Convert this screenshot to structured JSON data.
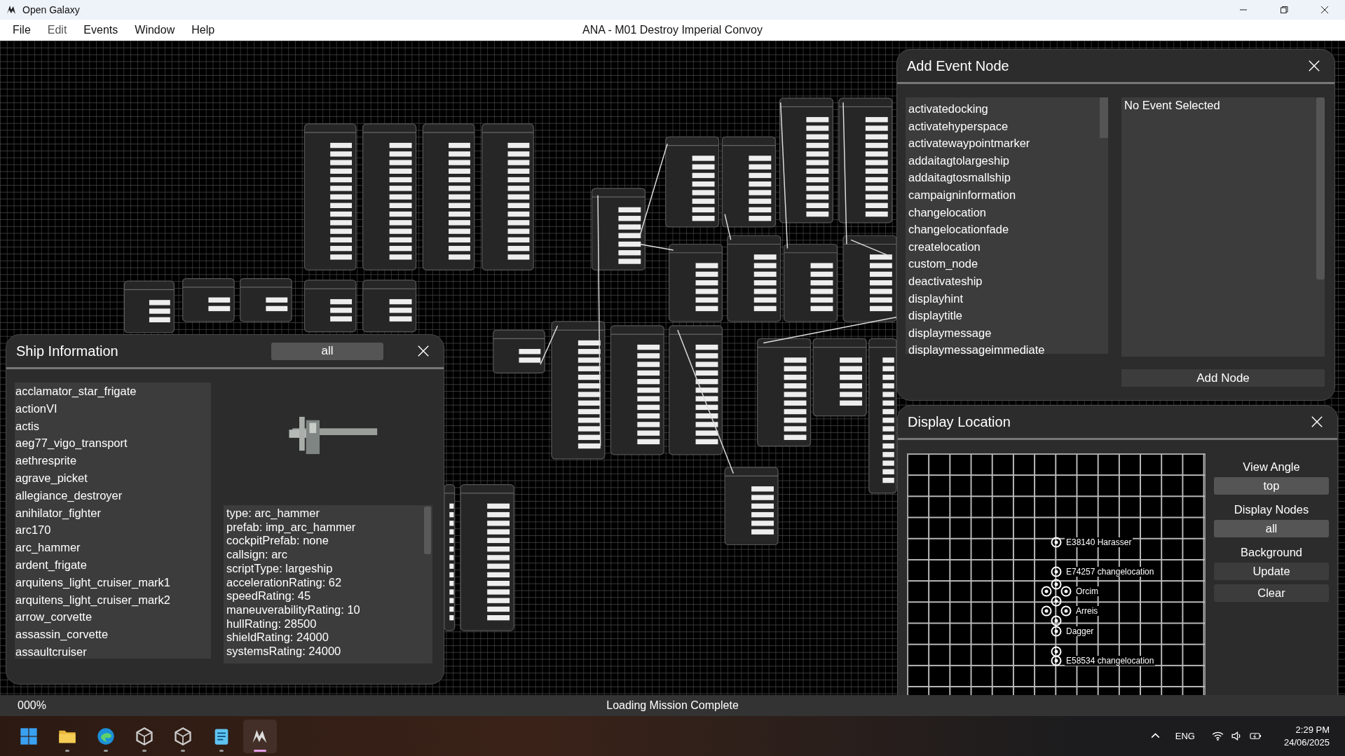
{
  "window": {
    "title": "Open Galaxy"
  },
  "menu": [
    "File",
    "Edit",
    "Events",
    "Window",
    "Help"
  ],
  "document_title": "ANA - M01 Destroy Imperial Convoy",
  "ship_information": {
    "title": "Ship Information",
    "filter": "all",
    "ships": [
      "acclamator_star_frigate",
      "actionVI",
      "actis",
      "aeg77_vigo_transport",
      "aethresprite",
      "agrave_picket",
      "allegiance_destroyer",
      "anihilator_fighter",
      "arc170",
      "arc_hammer",
      "ardent_frigate",
      "arquitens_light_cruiser_mark1",
      "arquitens_light_cruiser_mark2",
      "arrow_corvette",
      "assassin_corvette",
      "assaultcruiser"
    ],
    "details": [
      "type: arc_hammer",
      "prefab: imp_arc_hammer",
      "cockpitPrefab: none",
      "callsign: arc",
      "scriptType: largeship",
      "accelerationRating: 62",
      "speedRating: 45",
      "maneuverabilityRating: 10",
      "hullRating: 28500",
      "shieldRating: 24000",
      "systemsRating: 24000"
    ]
  },
  "add_event_node": {
    "title": "Add Event Node",
    "events": [
      "activatedocking",
      "activatehyperspace",
      "activatewaypointmarker",
      "addaitagtolargeship",
      "addaitagtosmallship",
      "campaigninformation",
      "changelocation",
      "changelocationfade",
      "createlocation",
      "custom_node",
      "deactivateship",
      "displayhint",
      "displaytitle",
      "displaymessage",
      "displaymessageimmediate"
    ],
    "description": "No Event Selected",
    "button": "Add Node"
  },
  "display_location": {
    "title": "Display Location",
    "markers": [
      {
        "label": "E38140 Harasser"
      },
      {
        "label": "E74257 changelocation"
      },
      {
        "label": "Orcim"
      },
      {
        "label": "Arreis"
      },
      {
        "label": "Dagger"
      },
      {
        "label": "E58534 changelocation"
      }
    ],
    "controls": [
      {
        "kind": "label",
        "text": "View Angle"
      },
      {
        "kind": "button",
        "text": "top"
      },
      {
        "kind": "label",
        "text": "Display Nodes"
      },
      {
        "kind": "button",
        "text": "all"
      },
      {
        "kind": "label",
        "text": "Background"
      },
      {
        "kind": "button",
        "text": "Update"
      },
      {
        "kind": "button",
        "text": "Clear"
      }
    ]
  },
  "status_bar": {
    "progress": "000%",
    "message": "Loading Mission Complete"
  },
  "taskbar": {
    "apps": [
      {
        "kind": "start",
        "active": false
      },
      {
        "kind": "folder",
        "active": false
      },
      {
        "kind": "browser",
        "active": false
      },
      {
        "kind": "cube",
        "active": false
      },
      {
        "kind": "cube",
        "active": false
      },
      {
        "kind": "notepad",
        "active": false
      },
      {
        "kind": "galaxy",
        "active": true
      }
    ],
    "language": "ENG",
    "time": "2:29 PM",
    "date": "24/06/2025"
  }
}
